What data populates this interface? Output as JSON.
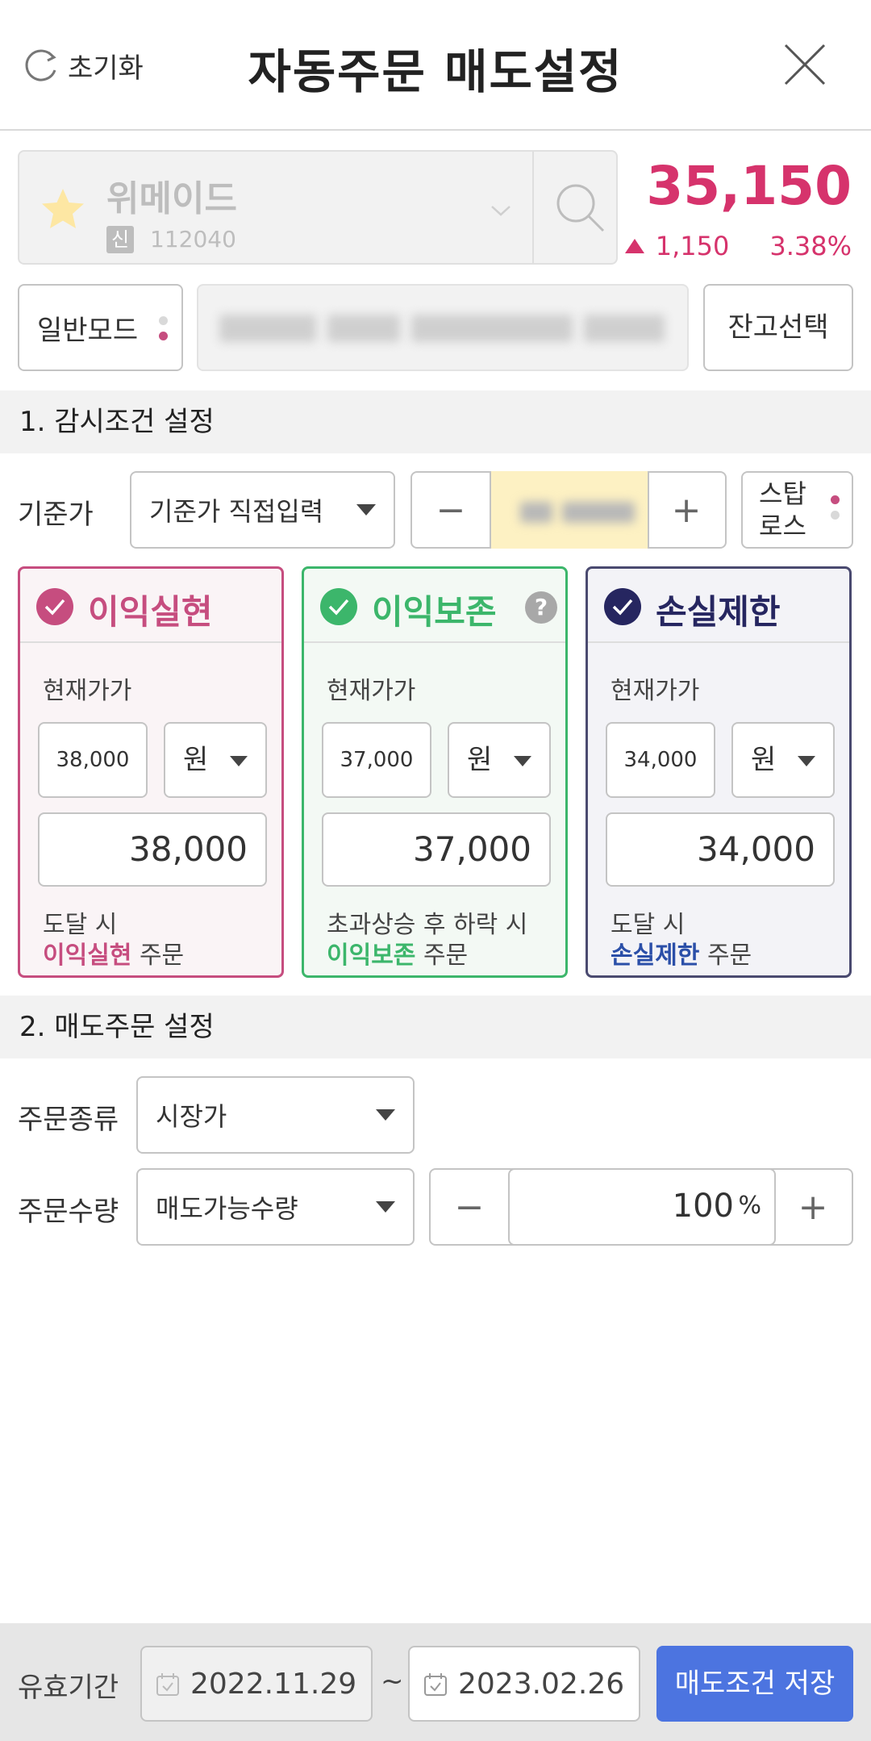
{
  "header": {
    "reset_label": "초기화",
    "title": "자동주문 매도설정"
  },
  "stock": {
    "name": "위메이드",
    "badge": "신",
    "code": "112040",
    "price": "35,150",
    "change": "1,150",
    "change_pct": "3.38%",
    "direction": "up",
    "accent_color": "#d6336c"
  },
  "mode": {
    "mode_label": "일반모드",
    "balance_button": "잔고선택"
  },
  "section1": {
    "title": "1. 감시조건 설정",
    "base_label": "기준가",
    "base_type": "기준가 직접입력",
    "stop_button_line1": "스탑",
    "stop_button_line2": "로스"
  },
  "cards": [
    {
      "title": "이익실현",
      "color": "#c64d7f",
      "sub": "현재가가",
      "small_value": "38,000",
      "unit": "원",
      "value": "38,000",
      "desc_line1": "도달 시",
      "desc_highlight": "이익실현",
      "desc_suffix": " 주문"
    },
    {
      "title": "이익보존",
      "color": "#3cb66b",
      "sub": "현재가가",
      "small_value": "37,000",
      "unit": "원",
      "value": "37,000",
      "desc_line1": "초과상승 후 하락 시",
      "desc_highlight": "이익보존",
      "desc_suffix": " 주문",
      "help": "?"
    },
    {
      "title": "손실제한",
      "color": "#262660",
      "sub": "현재가가",
      "small_value": "34,000",
      "unit": "원",
      "value": "34,000",
      "desc_line1": "도달 시",
      "desc_highlight": "손실제한",
      "desc_suffix": " 주문"
    }
  ],
  "section2": {
    "title": "2. 매도주문 설정",
    "order_type_label": "주문종류",
    "order_type_value": "시장가",
    "order_qty_label": "주문수량",
    "order_qty_type": "매도가능수량",
    "qty_value": "100",
    "qty_unit": "%"
  },
  "footer": {
    "label": "유효기간",
    "start_date": "2022.11.29",
    "separator": "~",
    "end_date": "2023.02.26",
    "save_button": "매도조건 저장"
  },
  "icons": {
    "reset": "refresh-icon",
    "close": "close-icon",
    "favorite": "star-icon",
    "search": "search-icon",
    "dropdown": "chevron-down-icon",
    "calendar": "calendar-icon",
    "check": "check-icon"
  }
}
